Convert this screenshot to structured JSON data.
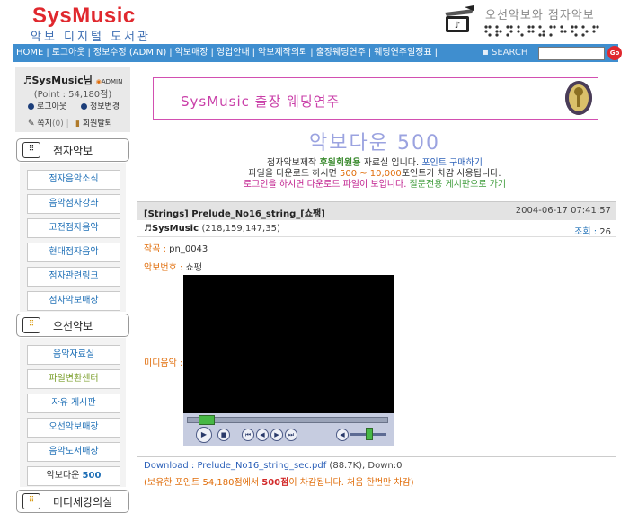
{
  "header": {
    "logo_title": "SysMusic",
    "logo_subtitle": "악보 디지털 도서관",
    "braille_title": "오선악보와 점자악보"
  },
  "nav": {
    "items": [
      "HOME",
      "로그아웃",
      "정보수정 (ADMIN)",
      "악보매장",
      "영업안내",
      "악보제작의뢰",
      "출장웨딩연주",
      "웨딩연주일정표"
    ],
    "search_label": "SEARCH",
    "search_value": "",
    "go_label": "Go"
  },
  "user": {
    "name": "SysMusic님",
    "badge": "ADMIN",
    "point": "(Point : 54,180점)",
    "logout": "로그아웃",
    "profile": "정보변경",
    "memo": "쪽지",
    "memo_count": "(0)",
    "withdraw": "회원탈퇴"
  },
  "sidebar": {
    "braille_section": "점자악보",
    "braille_items": [
      "점자음악소식",
      "음악점자강좌",
      "고전점자음악",
      "현대점자음악",
      "점자관련링크",
      "점자악보매장"
    ],
    "staff_section": "오선악보",
    "staff_items": [
      "음악자료실",
      "파일변환센터",
      "자유 게시판",
      "오선악보매장",
      "음악도서매장"
    ],
    "staff_last_item_text": "악보다운 ",
    "staff_last_item_bold": "500",
    "next_section": "미디세강의실"
  },
  "banner": {
    "text": "SysMusic 출장 웨딩연주"
  },
  "main": {
    "heading": "악보다운 500",
    "info1_a": "점자악보제작 ",
    "info1_b": "후원회원용",
    "info1_c": " 자료실 입니다. ",
    "info1_d": "포인트 구매하기",
    "info2_a": "파일을 다운로드 하시면 ",
    "info2_b": "500 ~ 10,000",
    "info2_c": "포인트가 차감 사용됩니다.",
    "info3_a": "로그인을 하시면 다운로드 파일이 보입니다.",
    "info3_b": " 질문전용 게시판으로 가기"
  },
  "post": {
    "title": "[Strings] Prelude_No16_string_[쇼팽]",
    "date": "2004-06-17 07:41:57",
    "author": "SysMusic",
    "ip": "(218,159,147,35)",
    "views_label": "조회 : ",
    "views": "26",
    "composer_label": "작곡 : ",
    "composer": "pn_0043",
    "number_label": "악보번호 : ",
    "number": "쇼팽",
    "media_label": "미디음악 :",
    "player": {
      "progress": 0.06,
      "volume": 0.5
    },
    "download_label": "Download : ",
    "download_file": "Prelude_No16_string_sec.pdf",
    "download_size": " (88.7K), Down:0",
    "note_a": "(보유한 포인트 54,180점에서 ",
    "note_b": "500점",
    "note_c": "이 차감됩니다. 처음 한번만 차감)"
  }
}
